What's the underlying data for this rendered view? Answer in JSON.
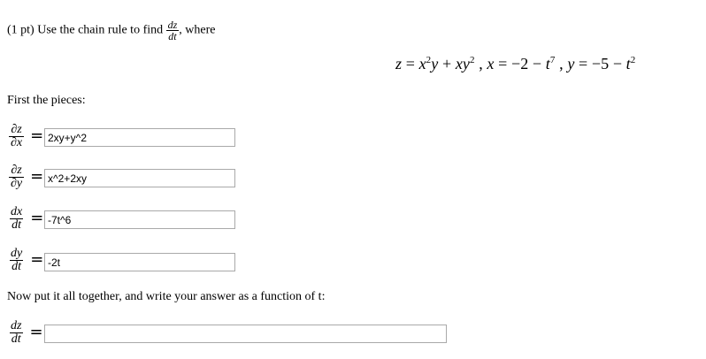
{
  "problem": {
    "points": "(1 pt)",
    "prefix": "Use the chain rule to find",
    "target_num": "dz",
    "target_den": "dt",
    "suffix": ", where"
  },
  "equation": {
    "text_parts": {
      "z": "z",
      "eq1": " = ",
      "x1": "x",
      "p2a": "2",
      "y1": "y",
      "plus": " + ",
      "x2": "x",
      "y2": "y",
      "p2b": "2",
      "comma1": " , ",
      "x3": "x",
      "eq2": " = ",
      "neg2": "−2",
      "minus1": " − ",
      "t1": "t",
      "p7": "7",
      "comma2": " , ",
      "y3": "y",
      "eq3": " = ",
      "neg5": "−5",
      "minus2": " − ",
      "t2": "t",
      "p2c": "2"
    }
  },
  "pieces_heading": "First the pieces:",
  "pieces": [
    {
      "num": "∂z",
      "den": "∂x",
      "value": "2xy+y^2"
    },
    {
      "num": "∂z",
      "den": "∂y",
      "value": "x^2+2xy"
    },
    {
      "num": "dx",
      "den": "dt",
      "value": "-7t^6"
    },
    {
      "num": "dy",
      "den": "dt",
      "value": "-2t"
    }
  ],
  "together_text": "Now put it all together, and write your answer as a function of t:",
  "final": {
    "num": "dz",
    "den": "dt",
    "value": ""
  },
  "equals_sign": "="
}
